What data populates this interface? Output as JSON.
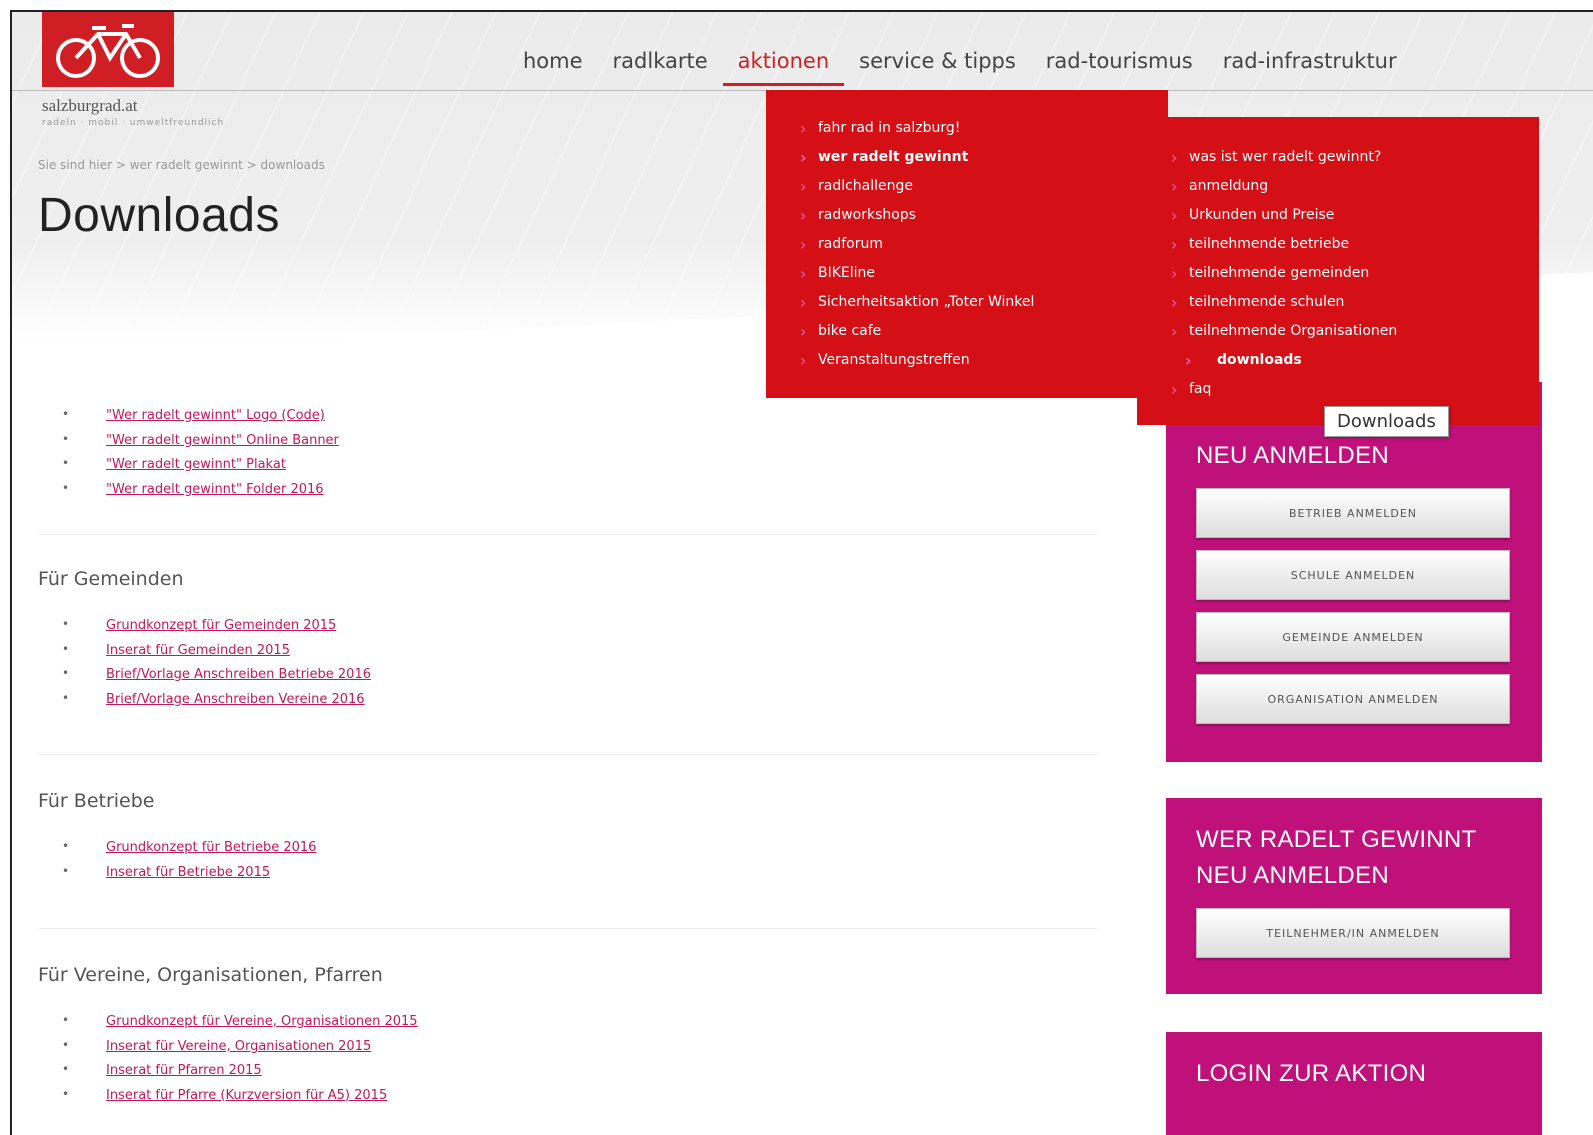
{
  "brand": {
    "name": "salzburgrad.at",
    "tagline": "radeln · mobil · umweltfreundlich"
  },
  "nav": {
    "items": [
      "home",
      "radlkarte",
      "aktionen",
      "service & tipps",
      "rad-tourismus",
      "rad-infrastruktur"
    ],
    "active": "aktionen"
  },
  "breadcrumb": "Sie sind hier > wer radelt gewinnt > downloads",
  "page_title": "Downloads",
  "sections": [
    {
      "title": "",
      "links": [
        "\"Wer radelt gewinnt\" Logo (Code)",
        "\"Wer radelt gewinnt\" Online Banner",
        "\"Wer radelt gewinnt\" Plakat",
        "\"Wer radelt gewinnt\" Folder 2016"
      ]
    },
    {
      "title": "Für Gemeinden",
      "links": [
        "Grundkonzept für Gemeinden 2015",
        "Inserat für Gemeinden 2015",
        "Brief/Vorlage Anschreiben Betriebe 2016",
        "Brief/Vorlage Anschreiben Vereine 2016"
      ]
    },
    {
      "title": "Für Betriebe",
      "links": [
        "Grundkonzept für Betriebe 2016",
        "Inserat für Betriebe 2015"
      ]
    },
    {
      "title": "Für Vereine, Organisationen, Pfarren",
      "links": [
        "Grundkonzept für Vereine, Organisationen 2015",
        "Inserat für Vereine, Organisationen 2015",
        "Inserat für Pfarren 2015",
        "Inserat für Pfarre (Kurzversion für A5) 2015"
      ]
    }
  ],
  "dropdown": {
    "left": [
      "fahr rad in salzburg!",
      "wer radelt gewinnt",
      "radlchallenge",
      "radworkshops",
      "radforum",
      "BIKEline",
      "Sicherheitsaktion „Toter Winkel",
      "bike cafe",
      "Veranstaltungstreffen"
    ],
    "right": [
      "was ist wer radelt gewinnt?",
      "anmeldung",
      "Urkunden und Preise",
      "teilnehmende betriebe",
      "teilnehmende gemeinden",
      "teilnehmende schulen",
      "teilnehmende Organisationen",
      "downloads",
      "faq"
    ]
  },
  "tooltip": "Downloads",
  "sidebar": {
    "box1": {
      "title": "NEU ANMELDEN",
      "buttons": [
        "BETRIEB ANMELDEN",
        "SCHULE ANMELDEN",
        "GEMEINDE ANMELDEN",
        "ORGANISATION ANMELDEN"
      ]
    },
    "box2": {
      "title": "WER RADELT GEWINNT NEU ANMELDEN",
      "buttons": [
        "TEILNEHMER/IN ANMELDEN"
      ]
    },
    "box3": {
      "title": "LOGIN ZUR AKTION"
    }
  },
  "colors": {
    "brand_red": "#cf1f24",
    "dropdown_red": "#d50f16",
    "sidebar_magenta": "#c0117b"
  }
}
